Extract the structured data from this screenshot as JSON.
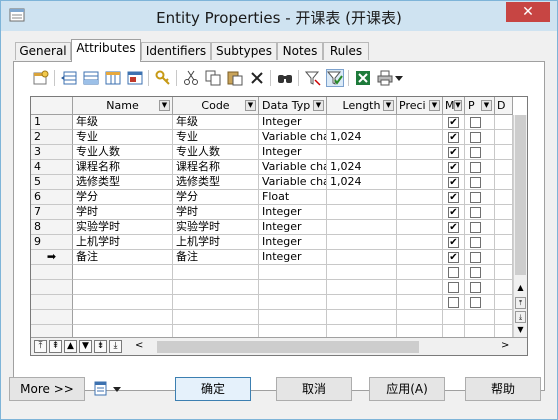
{
  "window": {
    "title": "Entity Properties - 开课表 (开课表)",
    "close_glyph": "✕"
  },
  "tabs": [
    "General",
    "Attributes",
    "Identifiers",
    "Subtypes",
    "Notes",
    "Rules"
  ],
  "active_tab": "Attributes",
  "toolbar_icons": [
    "properties-icon",
    "insert-row-icon",
    "add-row-icon",
    "add-columns-icon",
    "add-attribute-icon",
    "key-icon",
    "cut-icon",
    "copy-icon",
    "paste-icon",
    "delete-icon",
    "find-icon",
    "filter-icon",
    "customize-columns-icon",
    "excel-icon",
    "print-icon",
    "more-icon"
  ],
  "grid": {
    "columns": [
      "Name",
      "Code",
      "Data Typ",
      "Length",
      "Preci",
      "M",
      "P",
      "D"
    ],
    "rows": [
      {
        "num": "1",
        "name": "年级",
        "code": "年级",
        "type": "Integer",
        "length": "",
        "m": true,
        "p": false
      },
      {
        "num": "2",
        "name": "专业",
        "code": "专业",
        "type": "Variable char",
        "length": "1,024",
        "m": true,
        "p": false
      },
      {
        "num": "3",
        "name": "专业人数",
        "code": "专业人数",
        "type": "Integer",
        "length": "",
        "m": true,
        "p": false
      },
      {
        "num": "4",
        "name": "课程名称",
        "code": "课程名称",
        "type": "Variable char",
        "length": "1,024",
        "m": true,
        "p": false
      },
      {
        "num": "5",
        "name": "选修类型",
        "code": "选修类型",
        "type": "Variable char",
        "length": "1,024",
        "m": true,
        "p": false
      },
      {
        "num": "6",
        "name": "学分",
        "code": "学分",
        "type": "Float",
        "length": "",
        "m": true,
        "p": false
      },
      {
        "num": "7",
        "name": "学时",
        "code": "学时",
        "type": "Integer",
        "length": "",
        "m": true,
        "p": false
      },
      {
        "num": "8",
        "name": "实验学时",
        "code": "实验学时",
        "type": "Integer",
        "length": "",
        "m": true,
        "p": false
      },
      {
        "num": "9",
        "name": "上机学时",
        "code": "上机学时",
        "type": "Integer",
        "length": "",
        "m": true,
        "p": false
      },
      {
        "num": "➡",
        "name": "备注",
        "code": "备注",
        "type": "Integer",
        "length": "",
        "m": true,
        "p": false
      }
    ],
    "empty_rows": 6,
    "nav_glyphs": [
      "⤒",
      "⇞",
      "▲",
      "▼",
      "⇟",
      "⤓"
    ]
  },
  "buttons": {
    "more": "More >>",
    "ok": "确定",
    "cancel": "取消",
    "apply": "应用(A)",
    "help": "帮助"
  }
}
